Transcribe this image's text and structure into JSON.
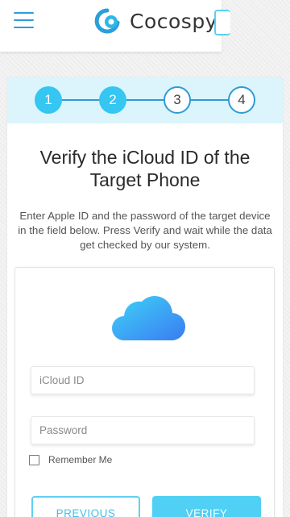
{
  "header": {
    "brand": "Cocospy",
    "menu_icon": "hamburger-menu-icon",
    "logo_icon": "cocospy-logo-icon"
  },
  "steps": [
    {
      "number": "1",
      "state": "done"
    },
    {
      "number": "2",
      "state": "done"
    },
    {
      "number": "3",
      "state": "todo"
    },
    {
      "number": "4",
      "state": "todo"
    }
  ],
  "main": {
    "title": "Verify the iCloud ID of the Target Phone",
    "description": "Enter Apple ID and the password of the target device in the field below. Press Verify and wait while the data get checked by our system."
  },
  "form": {
    "cloud_icon": "icloud-icon",
    "icloud_placeholder": "iCloud ID",
    "icloud_value": "",
    "password_placeholder": "Password",
    "password_value": "",
    "remember_label": "Remember Me",
    "remember_checked": false,
    "previous_label": "PREVIOUS",
    "verify_label": "VERIFY"
  },
  "colors": {
    "accent": "#35c6f1",
    "step_line": "#2f9bd6",
    "steps_bg": "#dcf5fd"
  }
}
